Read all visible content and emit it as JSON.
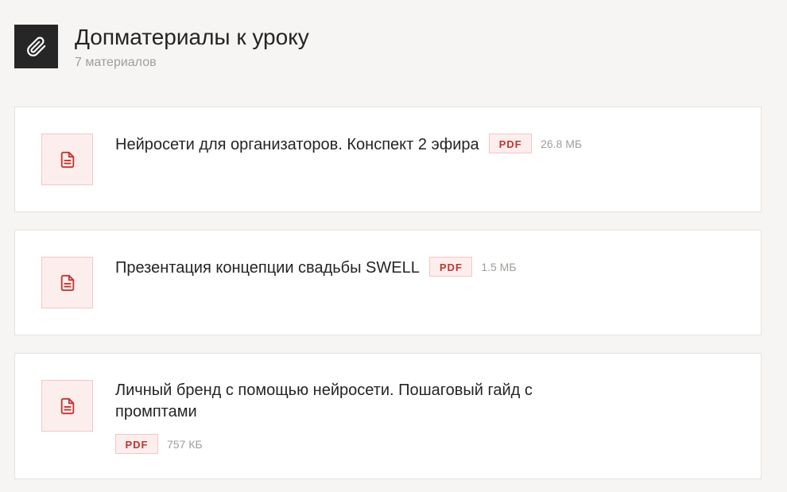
{
  "header": {
    "icon": "paperclip-icon",
    "title": "Допматериалы к уроку",
    "subtitle": "7 материалов"
  },
  "materials": [
    {
      "icon": "document-icon",
      "title": "Нейросети для организаторов. Конспект 2 эфира",
      "badge": "PDF",
      "size": "26.8 МБ"
    },
    {
      "icon": "document-icon",
      "title": "Презентация концепции свадьбы SWELL",
      "badge": "PDF",
      "size": "1.5 МБ"
    },
    {
      "icon": "document-icon",
      "title": "Личный бренд с помощью нейросети. Пошаговый гайд с промптами",
      "badge": "PDF",
      "size": "757 КБ"
    }
  ],
  "colors": {
    "page_background": "#f6f5f3",
    "header_icon_background": "#262626",
    "accent_red": "#c2342f",
    "badge_background": "#fdeeee",
    "badge_border": "#f1c7c7",
    "muted_text": "#a19d99"
  }
}
